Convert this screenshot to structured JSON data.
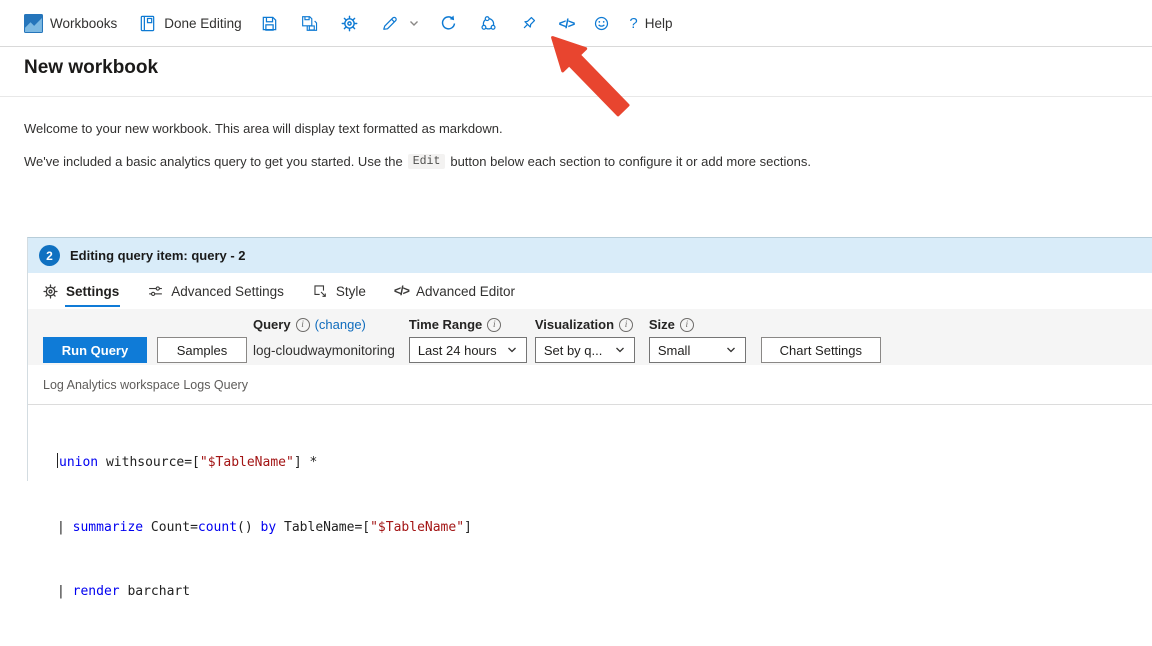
{
  "glyphs": {
    "code": "</>",
    "question": "?",
    "info": "i"
  },
  "colors": {
    "accent": "#0078d4",
    "section_header_bg": "#d9ecf9",
    "badge_blue": "#1071c1",
    "arrow_red": "#e8452f",
    "code_keyword": "#0000f0",
    "code_string": "#a31515"
  },
  "toolbar": {
    "workbooks": "Workbooks",
    "done_editing": "Done Editing",
    "help": "Help"
  },
  "page": {
    "title": "New workbook",
    "p1": "Welcome to your new workbook. This area will display text formatted as markdown.",
    "p2_before": "We've included a basic analytics query to get you started. Use the",
    "p2_chip": "Edit",
    "p2_after": "button below each section to configure it or add more sections."
  },
  "query_section": {
    "badge": "2",
    "title": "Editing query item: query - 2",
    "tabs": [
      {
        "label": "Settings"
      },
      {
        "label": "Advanced Settings"
      },
      {
        "label": "Style"
      },
      {
        "label": "Advanced Editor"
      }
    ],
    "controls": {
      "run_query": "Run Query",
      "samples": "Samples",
      "query_label": "Query",
      "change_link": "(change)",
      "workspace": "log-cloudwaymonitoring",
      "time_range_label": "Time Range",
      "time_range_value": "Last 24 hours",
      "visualization_label": "Visualization",
      "visualization_value": "Set by q...",
      "size_label": "Size",
      "size_value": "Small",
      "chart_settings": "Chart Settings"
    },
    "logs_label": "Log Analytics workspace Logs Query",
    "code": {
      "line1": [
        "union",
        " withsource=[",
        "\"$TableName\"",
        "] *"
      ],
      "line2": [
        "| ",
        "summarize",
        " Count=",
        "count",
        "() ",
        "by",
        " TableName=[",
        "\"$TableName\"",
        "]"
      ],
      "line3": [
        "| ",
        "render",
        " barchart"
      ]
    }
  }
}
